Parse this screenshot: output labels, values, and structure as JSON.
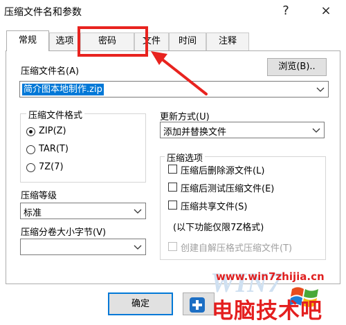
{
  "window": {
    "title": "压缩文件名和参数",
    "help": "?",
    "close": "×"
  },
  "tabs": [
    "常规",
    "选项",
    "密码",
    "文件",
    "时间",
    "注释"
  ],
  "archive_name": {
    "label": "压缩文件名(A)",
    "browse": "浏览(B)..",
    "value": "简介图本地制作.zip"
  },
  "format": {
    "label": "压缩文件格式",
    "options": [
      "ZIP(Z)",
      "TAR(T)",
      "7Z(7)"
    ],
    "selected": "ZIP(Z)"
  },
  "update": {
    "label": "更新方式(U)",
    "value": "添加并替换文件"
  },
  "level": {
    "label": "压缩等级",
    "value": "标准"
  },
  "split": {
    "label": "压缩分卷大小字节(V)",
    "value": ""
  },
  "options": {
    "label": "压缩选项",
    "items": [
      "压缩后删除源文件(L)",
      "压缩后测试压缩文件(E)",
      "压缩共享文件(S)"
    ],
    "note": "(以下功能仅限7Z格式)",
    "disabled_item": "创建自解压格式压缩文件(T)"
  },
  "buttons": {
    "ok": "确定"
  },
  "watermark": {
    "url": "www.win7zhijia.cn",
    "brand": "电脑技术吧"
  },
  "colors": {
    "accent": "#0078d7",
    "annotation_red": "#e8231f"
  }
}
